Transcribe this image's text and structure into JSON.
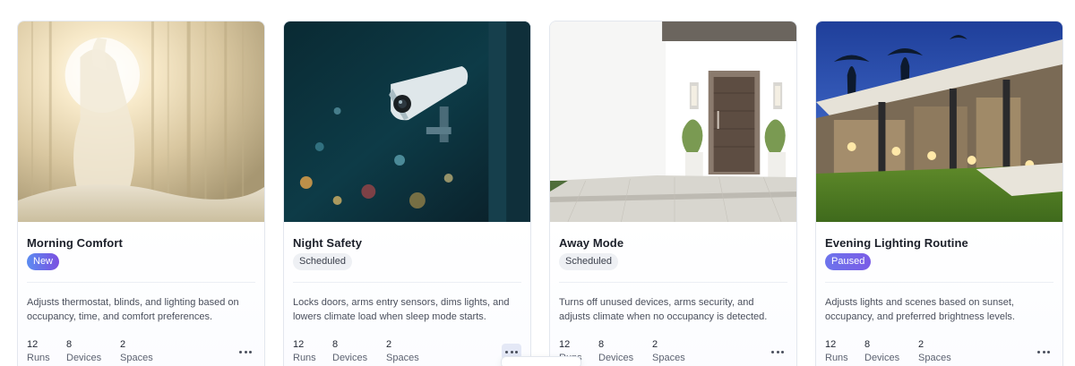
{
  "cards": [
    {
      "title": "Morning Comfort",
      "badge": "New",
      "description": "Adjusts thermostat, blinds, and lighting based on occupancy, time, and comfort preferences.",
      "stats": {
        "runs": "12",
        "devices": "8",
        "spaces": "2"
      },
      "image": "sunlit-window-stretching"
    },
    {
      "title": "Night Safety",
      "badge": "Scheduled",
      "description": "Locks doors, arms entry sensors, dims lights, and lowers climate load when sleep mode starts.",
      "stats": {
        "runs": "12",
        "devices": "8",
        "spaces": "2"
      },
      "image": "security-camera-night"
    },
    {
      "title": "Away Mode",
      "badge": "Scheduled",
      "description": "Turns off unused devices, arms security, and adjusts climate when no occupancy is detected.",
      "stats": {
        "runs": "12",
        "devices": "8",
        "spaces": "2"
      },
      "image": "front-door-entrance"
    },
    {
      "title": "Evening Lighting Routine",
      "badge": "Paused",
      "description": "Adjusts lights and scenes based on sunset, occupancy, and preferred brightness levels.",
      "stats": {
        "runs": "12",
        "devices": "8",
        "spaces": "2"
      },
      "image": "house-lit-evening"
    }
  ],
  "labels": {
    "runs": "Runs",
    "devices": "Devices",
    "spaces": "Spaces"
  },
  "icons": {
    "more": "more-horizontal-icon"
  },
  "colors": {
    "accent": "#6d5ce6",
    "border": "#e3e7ee",
    "text": "#1b1f29",
    "muted": "#4a4f5c"
  }
}
